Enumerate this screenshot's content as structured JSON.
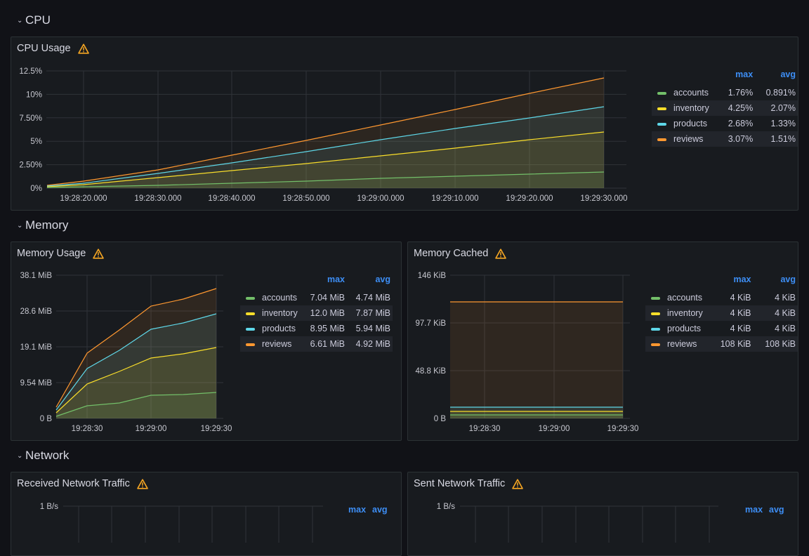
{
  "colors": {
    "accounts": "#73bf69",
    "inventory": "#fade2a",
    "products": "#5ed7e8",
    "reviews": "#ff9830",
    "warn": "#f5a623",
    "link": "#3d8ef5"
  },
  "rows": {
    "cpu": "CPU",
    "memory": "Memory",
    "network": "Network"
  },
  "legend_headers": {
    "max": "max",
    "avg": "avg"
  },
  "cpu_usage": {
    "title": "CPU Usage",
    "y_ticks": [
      "0%",
      "2.50%",
      "5%",
      "7.50%",
      "10%",
      "12.5%"
    ],
    "x_ticks": [
      "19:28:20.000",
      "19:28:30.000",
      "19:28:40.000",
      "19:28:50.000",
      "19:29:00.000",
      "19:29:10.000",
      "19:29:20.000",
      "19:29:30.000"
    ],
    "legend": [
      {
        "name": "accounts",
        "max": "1.76%",
        "avg": "0.891%"
      },
      {
        "name": "inventory",
        "max": "4.25%",
        "avg": "2.07%"
      },
      {
        "name": "products",
        "max": "2.68%",
        "avg": "1.33%"
      },
      {
        "name": "reviews",
        "max": "3.07%",
        "avg": "1.51%"
      }
    ]
  },
  "memory_usage": {
    "title": "Memory Usage",
    "y_ticks": [
      "0 B",
      "9.54 MiB",
      "19.1 MiB",
      "28.6 MiB",
      "38.1 MiB"
    ],
    "x_ticks": [
      "19:28:30",
      "19:29:00",
      "19:29:30"
    ],
    "legend": [
      {
        "name": "accounts",
        "max": "7.04 MiB",
        "avg": "4.74 MiB"
      },
      {
        "name": "inventory",
        "max": "12.0 MiB",
        "avg": "7.87 MiB"
      },
      {
        "name": "products",
        "max": "8.95 MiB",
        "avg": "5.94 MiB"
      },
      {
        "name": "reviews",
        "max": "6.61 MiB",
        "avg": "4.92 MiB"
      }
    ]
  },
  "memory_cached": {
    "title": "Memory Cached",
    "y_ticks": [
      "0 B",
      "48.8 KiB",
      "97.7 KiB",
      "146 KiB"
    ],
    "x_ticks": [
      "19:28:30",
      "19:29:00",
      "19:29:30"
    ],
    "legend": [
      {
        "name": "accounts",
        "max": "4 KiB",
        "avg": "4 KiB"
      },
      {
        "name": "inventory",
        "max": "4 KiB",
        "avg": "4 KiB"
      },
      {
        "name": "products",
        "max": "4 KiB",
        "avg": "4 KiB"
      },
      {
        "name": "reviews",
        "max": "108 KiB",
        "avg": "108 KiB"
      }
    ]
  },
  "received_traffic": {
    "title": "Received Network Traffic",
    "y_top": "1 B/s"
  },
  "sent_traffic": {
    "title": "Sent Network Traffic",
    "y_top": "1 B/s"
  }
}
